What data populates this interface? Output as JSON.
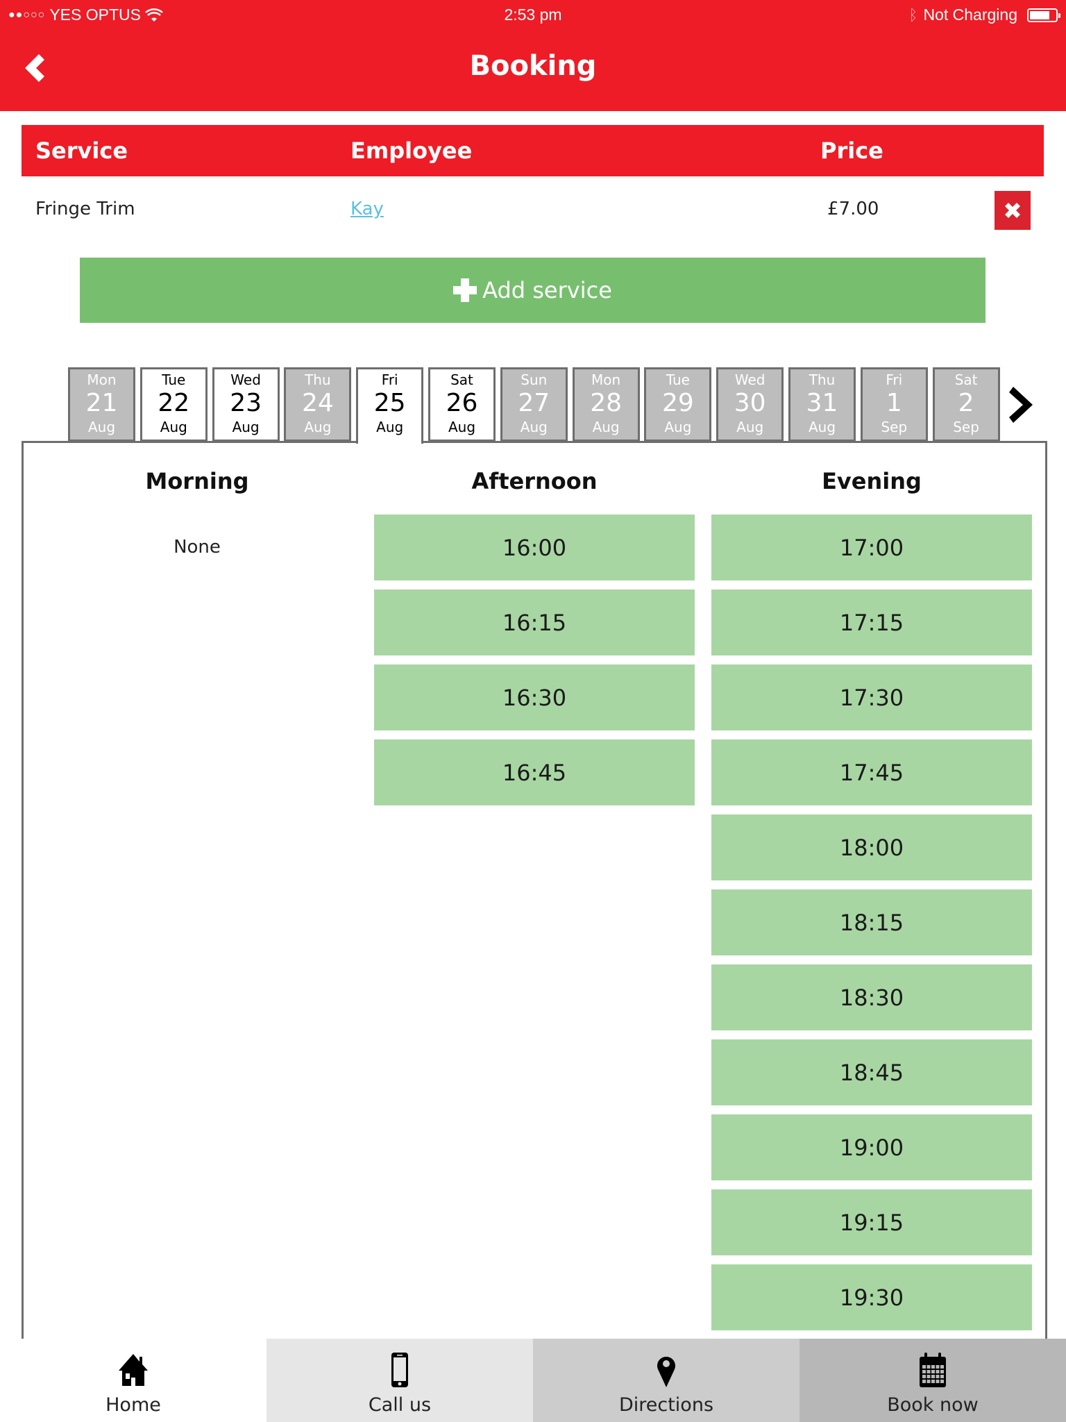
{
  "status_bar": {
    "signal": "●●○○○",
    "carrier": "YES OPTUS",
    "time": "2:53 pm",
    "charging": "Not Charging"
  },
  "header": {
    "title": "Booking"
  },
  "services_table": {
    "headers": {
      "service": "Service",
      "employee": "Employee",
      "price": "Price"
    },
    "rows": [
      {
        "service": "Fringe Trim",
        "employee": "Kay",
        "price": "£7.00"
      }
    ]
  },
  "add_service_label": "Add service",
  "dates": [
    {
      "dow": "Mon",
      "day": "21",
      "month": "Aug",
      "state": "unavailable"
    },
    {
      "dow": "Tue",
      "day": "22",
      "month": "Aug",
      "state": "available"
    },
    {
      "dow": "Wed",
      "day": "23",
      "month": "Aug",
      "state": "available"
    },
    {
      "dow": "Thu",
      "day": "24",
      "month": "Aug",
      "state": "unavailable"
    },
    {
      "dow": "Fri",
      "day": "25",
      "month": "Aug",
      "state": "selected"
    },
    {
      "dow": "Sat",
      "day": "26",
      "month": "Aug",
      "state": "available"
    },
    {
      "dow": "Sun",
      "day": "27",
      "month": "Aug",
      "state": "unavailable"
    },
    {
      "dow": "Mon",
      "day": "28",
      "month": "Aug",
      "state": "unavailable"
    },
    {
      "dow": "Tue",
      "day": "29",
      "month": "Aug",
      "state": "unavailable"
    },
    {
      "dow": "Wed",
      "day": "30",
      "month": "Aug",
      "state": "unavailable"
    },
    {
      "dow": "Thu",
      "day": "31",
      "month": "Aug",
      "state": "unavailable"
    },
    {
      "dow": "Fri",
      "day": "1",
      "month": "Sep",
      "state": "unavailable"
    },
    {
      "dow": "Sat",
      "day": "2",
      "month": "Sep",
      "state": "unavailable"
    }
  ],
  "slots": {
    "morning": {
      "label": "Morning",
      "empty_text": "None",
      "times": []
    },
    "afternoon": {
      "label": "Afternoon",
      "times": [
        "16:00",
        "16:15",
        "16:30",
        "16:45"
      ]
    },
    "evening": {
      "label": "Evening",
      "times": [
        "17:00",
        "17:15",
        "17:30",
        "17:45",
        "18:00",
        "18:15",
        "18:30",
        "18:45",
        "19:00",
        "19:15",
        "19:30",
        ""
      ]
    }
  },
  "bottom_nav": [
    {
      "label": "Home",
      "icon": "home-icon",
      "bg": "#ffffff"
    },
    {
      "label": "Call us",
      "icon": "phone-icon",
      "bg": "#e6e6e6"
    },
    {
      "label": "Directions",
      "icon": "map-pin-icon",
      "bg": "#cccccc"
    },
    {
      "label": "Book now",
      "icon": "calendar-icon",
      "bg": "#b7b7b7"
    }
  ],
  "colors": {
    "brand_red": "#ed1c26",
    "add_green": "#77bf6f",
    "slot_green": "#a8d6a3",
    "unavailable_grey": "#bdbdbd",
    "link_blue": "#5bc0de"
  }
}
